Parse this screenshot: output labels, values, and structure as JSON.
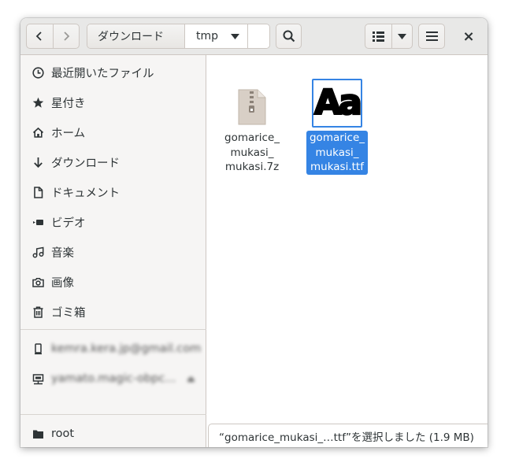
{
  "header": {
    "path": [
      "ダウンロード",
      "tmp"
    ],
    "close_glyph": "×"
  },
  "sidebar": {
    "places": [
      {
        "label": "最近開いたファイル",
        "icon": "clock-icon"
      },
      {
        "label": "星付き",
        "icon": "star-icon"
      },
      {
        "label": "ホーム",
        "icon": "home-icon"
      },
      {
        "label": "ダウンロード",
        "icon": "download-icon"
      },
      {
        "label": "ドキュメント",
        "icon": "document-icon"
      },
      {
        "label": "ビデオ",
        "icon": "video-icon"
      },
      {
        "label": "音楽",
        "icon": "music-icon"
      },
      {
        "label": "画像",
        "icon": "camera-icon"
      },
      {
        "label": "ゴミ箱",
        "icon": "trash-icon"
      }
    ],
    "accounts": [
      {
        "label": "kemra.kera.jp@gmail.com",
        "icon": "phone-icon"
      },
      {
        "label": "yamato.magic-obpc...",
        "icon": "network-drive-icon"
      }
    ],
    "devices": [
      {
        "label": "root",
        "icon": "folder-icon"
      }
    ]
  },
  "files": [
    {
      "name": "gomarice_\nmukasi_\nmukasi.7z",
      "lines": [
        "gomarice_",
        "mukasi_",
        "mukasi.7z"
      ],
      "type": "archive",
      "selected": false
    },
    {
      "name": "gomarice_\nmukasi_\nmukasi.ttf",
      "lines": [
        "gomarice_",
        "mukasi_",
        "mukasi.ttf"
      ],
      "type": "font",
      "preview": "Aa",
      "selected": true
    }
  ],
  "status": "“gomarice_mukasi_…ttf”を選択しました (1.9 MB)",
  "colors": {
    "accent": "#3584e4",
    "sidebar_bg": "#f6f5f4",
    "header_bg": "#e8e8e7"
  }
}
